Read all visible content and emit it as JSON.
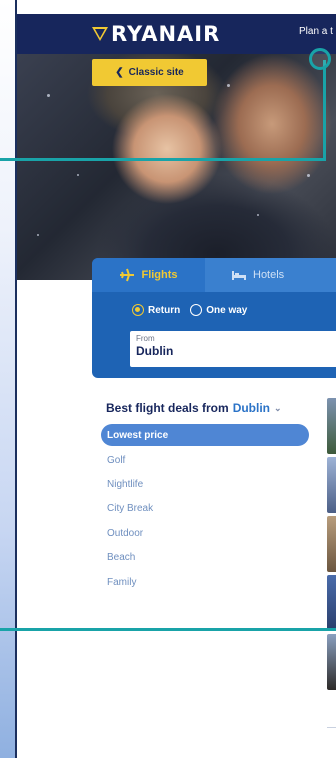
{
  "header": {
    "brand": "RYANAIR",
    "plan_link": "Plan a t"
  },
  "hero": {
    "classic_button": "Classic site"
  },
  "search": {
    "tabs": [
      {
        "label": "Flights",
        "icon": "plane-icon",
        "selected": true
      },
      {
        "label": "Hotels",
        "icon": "bed-icon",
        "selected": false
      }
    ],
    "trip_types": [
      {
        "label": "Return",
        "selected": true
      },
      {
        "label": "One way",
        "selected": false
      }
    ],
    "from_label": "From",
    "from_value": "Dublin"
  },
  "deals": {
    "title_prefix": "Best flight deals from",
    "city": "Dublin",
    "filters": [
      "Lowest price",
      "Golf",
      "Nightlife",
      "City Break",
      "Outdoor",
      "Beach",
      "Family"
    ],
    "active_filter": "Lowest price"
  },
  "colors": {
    "navy": "#17265c",
    "yellow": "#f1c933",
    "blue": "#1e63b4",
    "annotation_teal": "#19a3a8"
  }
}
